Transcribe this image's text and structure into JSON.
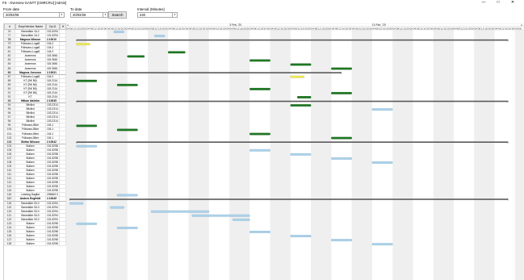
{
  "window": {
    "title": "FS - Overview GANTT [CMRCRU] [Admin]",
    "minimize": "—",
    "maximize": "□",
    "close": "✕"
  },
  "filters": {
    "from_label": "From date",
    "from_value": "20/02/06",
    "to_label": "To date",
    "to_value": "20/02/26",
    "interval_label": "Interval (Minutes)",
    "interval_value": "240",
    "search_label": "Search"
  },
  "grid": {
    "columns": [
      "#",
      "Emp/Vendor Name",
      "Op.D.",
      "H"
    ],
    "rows": [
      {
        "num": "76",
        "name": "Benedikte 16-2",
        "op": "101.5294",
        "grp": false
      },
      {
        "num": "77",
        "name": "Benedikte 16-2",
        "op": "101.5294",
        "grp": false
      },
      {
        "num": "78",
        "name": "Magnus Nilsson",
        "op": "2.10010",
        "grp": true
      },
      {
        "num": "79",
        "name": "Frånvaro-Logs8",
        "op": "104.2",
        "grp": false
      },
      {
        "num": "80",
        "name": "Frånvaro-Logs8",
        "op": "104.2",
        "grp": false
      },
      {
        "num": "81",
        "name": "Frånvaro-Logs8",
        "op": "104.2",
        "grp": false
      },
      {
        "num": "82",
        "name": "Avanmos",
        "op": "115.3661",
        "grp": false
      },
      {
        "num": "83",
        "name": "Avanmos",
        "op": "115.3661",
        "grp": false
      },
      {
        "num": "84",
        "name": "Avanmos",
        "op": "115.3661",
        "grp": false
      },
      {
        "num": "85",
        "name": "Avanmos",
        "op": "115.3661",
        "grp": false
      },
      {
        "num": "86",
        "name": "Magnus Jonsson",
        "op": "2.10031",
        "grp": true
      },
      {
        "num": "87",
        "name": "Frånvaro-Logs8",
        "op": "104.2",
        "grp": false
      },
      {
        "num": "88",
        "name": "KT (BK Bil)",
        "op": "115.2114",
        "grp": false
      },
      {
        "num": "89",
        "name": "KT (BK Bil)",
        "op": "115.2114",
        "grp": false
      },
      {
        "num": "90",
        "name": "KT (BK Bil)",
        "op": "115.2114",
        "grp": false
      },
      {
        "num": "91",
        "name": "KT (BK Bil)",
        "op": "115.2114",
        "grp": false
      },
      {
        "num": "92",
        "name": "KT",
        "op": "115.2114",
        "grp": false
      },
      {
        "num": "93",
        "name": "Håkan Idström",
        "op": "2.10035",
        "grp": true
      },
      {
        "num": "94",
        "name": "Bilvård",
        "op": "103.2314",
        "grp": false
      },
      {
        "num": "95",
        "name": "Bilvård",
        "op": "103.2314",
        "grp": false
      },
      {
        "num": "96",
        "name": "Bilvård",
        "op": "103.2314",
        "grp": false
      },
      {
        "num": "97",
        "name": "Bilvård",
        "op": "103.2314",
        "grp": false
      },
      {
        "num": "98",
        "name": "Bilvård",
        "op": "103.2314",
        "grp": false
      },
      {
        "num": "99",
        "name": "Frånvaro-Biter",
        "op": "104.1",
        "grp": false
      },
      {
        "num": "100",
        "name": "Frånvaro-Biter",
        "op": "104.1",
        "grp": false
      },
      {
        "num": "101",
        "name": "Frånvaro-Biter",
        "op": "104.1",
        "grp": false
      },
      {
        "num": "102",
        "name": "Frånvaro-Biter",
        "op": "104.1",
        "grp": false
      },
      {
        "num": "103",
        "name": "Stefan Nilsson",
        "op": "2.10042",
        "grp": true
      },
      {
        "num": "104",
        "name": "Bulken",
        "op": "101.5298",
        "grp": false
      },
      {
        "num": "105",
        "name": "Bulken",
        "op": "101.5298",
        "grp": false
      },
      {
        "num": "106",
        "name": "Bulken",
        "op": "101.5298",
        "grp": false
      },
      {
        "num": "107",
        "name": "Bulken",
        "op": "101.5298",
        "grp": false
      },
      {
        "num": "108",
        "name": "Bulken",
        "op": "101.5298",
        "grp": false
      },
      {
        "num": "109",
        "name": "Bulken",
        "op": "101.5298",
        "grp": false
      },
      {
        "num": "110",
        "name": "Bulken",
        "op": "101.5298",
        "grp": false
      },
      {
        "num": "111",
        "name": "Bulken",
        "op": "101.5298",
        "grp": false
      },
      {
        "num": "112",
        "name": "Bulken",
        "op": "101.5298",
        "grp": false
      },
      {
        "num": "113",
        "name": "Bulken",
        "op": "101.5298",
        "grp": false
      },
      {
        "num": "114",
        "name": "Bulken",
        "op": "101.5298",
        "grp": false
      },
      {
        "num": "115",
        "name": "Bulken",
        "op": "101.5298",
        "grp": false
      },
      {
        "num": "116",
        "name": "Leaning Daglist",
        "op": "205663.3",
        "grp": false
      },
      {
        "num": "117",
        "name": "Anders Engfeldt",
        "op": "2.10049",
        "grp": true
      },
      {
        "num": "118",
        "name": "Benedikte 00-0",
        "op": "101.5294",
        "grp": false
      },
      {
        "num": "119",
        "name": "Benedikte 00-0",
        "op": "101.5294",
        "grp": false
      },
      {
        "num": "120",
        "name": "Benedikte 00-0",
        "op": "101.5294",
        "grp": false
      },
      {
        "num": "121",
        "name": "Benedikte 00-0",
        "op": "101.5294",
        "grp": false
      },
      {
        "num": "122",
        "name": "Benedikte 00-0",
        "op": "101.5294",
        "grp": false
      },
      {
        "num": "123",
        "name": "Bulken",
        "op": "101.5298",
        "grp": false
      },
      {
        "num": "124",
        "name": "Bulken",
        "op": "101.5298",
        "grp": false
      },
      {
        "num": "125",
        "name": "Bulken",
        "op": "101.5298",
        "grp": false
      },
      {
        "num": "126",
        "name": "Bulken",
        "op": "101.5298",
        "grp": false
      },
      {
        "num": "127",
        "name": "Bulken",
        "op": "101.5298",
        "grp": false
      },
      {
        "num": "128",
        "name": "Bulken",
        "op": "101.5298",
        "grp": false
      }
    ]
  },
  "gantt": {
    "dates": [
      {
        "label": "3 Feb, '20",
        "col": 48
      },
      {
        "label": "10 Feb, '20",
        "col": 90
      }
    ],
    "hour_labels": [
      "00",
      "04",
      "08",
      "12",
      "16",
      "20"
    ],
    "start_hour_index": 1,
    "colors": {
      "light": "#aed4ec",
      "green": "#1d7a22",
      "yellow": "#f2ee55",
      "summary": "#595959",
      "shade": "#efefef",
      "band_border": "#dcdcdc"
    },
    "bars": [
      {
        "row": 0,
        "start": 14,
        "end": 17,
        "kind": "light"
      },
      {
        "row": 1,
        "start": 26,
        "end": 29,
        "kind": "light"
      },
      {
        "row": 2,
        "start": 3,
        "end": 130,
        "kind": "summary"
      },
      {
        "row": 3,
        "start": 3,
        "end": 7,
        "kind": "yellow"
      },
      {
        "row": 6,
        "start": 18,
        "end": 23,
        "kind": "green"
      },
      {
        "row": 5,
        "start": 30,
        "end": 35,
        "kind": "green"
      },
      {
        "row": 7,
        "start": 54,
        "end": 60,
        "kind": "green"
      },
      {
        "row": 8,
        "start": 66,
        "end": 72,
        "kind": "green"
      },
      {
        "row": 9,
        "start": 78,
        "end": 84,
        "kind": "green"
      },
      {
        "row": 10,
        "start": 3,
        "end": 81,
        "kind": "summary"
      },
      {
        "row": 11,
        "start": 66,
        "end": 70,
        "kind": "yellow"
      },
      {
        "row": 12,
        "start": 3,
        "end": 9,
        "kind": "green"
      },
      {
        "row": 13,
        "start": 15,
        "end": 21,
        "kind": "green"
      },
      {
        "row": 14,
        "start": 54,
        "end": 60,
        "kind": "green"
      },
      {
        "row": 15,
        "start": 78,
        "end": 84,
        "kind": "green"
      },
      {
        "row": 16,
        "start": 68,
        "end": 72,
        "kind": "green"
      },
      {
        "row": 17,
        "start": 3,
        "end": 130,
        "kind": "summary"
      },
      {
        "row": 18,
        "start": 66,
        "end": 72,
        "kind": "green"
      },
      {
        "row": 19,
        "start": 90,
        "end": 96,
        "kind": "light"
      },
      {
        "row": 23,
        "start": 3,
        "end": 9,
        "kind": "green"
      },
      {
        "row": 24,
        "start": 15,
        "end": 21,
        "kind": "green"
      },
      {
        "row": 25,
        "start": 54,
        "end": 60,
        "kind": "green"
      },
      {
        "row": 26,
        "start": 78,
        "end": 84,
        "kind": "green"
      },
      {
        "row": 27,
        "start": 3,
        "end": 130,
        "kind": "summary"
      },
      {
        "row": 28,
        "start": 3,
        "end": 9,
        "kind": "light"
      },
      {
        "row": 29,
        "start": 54,
        "end": 60,
        "kind": "light"
      },
      {
        "row": 30,
        "start": 66,
        "end": 72,
        "kind": "light"
      },
      {
        "row": 31,
        "start": 78,
        "end": 84,
        "kind": "light"
      },
      {
        "row": 32,
        "start": 90,
        "end": 96,
        "kind": "light"
      },
      {
        "row": 40,
        "start": 15,
        "end": 21,
        "kind": "light"
      },
      {
        "row": 41,
        "start": 1,
        "end": 130,
        "kind": "summary"
      },
      {
        "row": 42,
        "start": 1,
        "end": 5,
        "kind": "light"
      },
      {
        "row": 43,
        "start": 13,
        "end": 17,
        "kind": "light"
      },
      {
        "row": 44,
        "start": 25,
        "end": 42,
        "kind": "light"
      },
      {
        "row": 45,
        "start": 37,
        "end": 54,
        "kind": "light"
      },
      {
        "row": 46,
        "start": 49,
        "end": 54,
        "kind": "light"
      },
      {
        "row": 47,
        "start": 3,
        "end": 9,
        "kind": "light"
      },
      {
        "row": 48,
        "start": 15,
        "end": 21,
        "kind": "light"
      },
      {
        "row": 49,
        "start": 54,
        "end": 60,
        "kind": "light"
      },
      {
        "row": 50,
        "start": 66,
        "end": 72,
        "kind": "light"
      },
      {
        "row": 51,
        "start": 78,
        "end": 84,
        "kind": "light"
      },
      {
        "row": 52,
        "start": 90,
        "end": 96,
        "kind": "light"
      }
    ]
  }
}
